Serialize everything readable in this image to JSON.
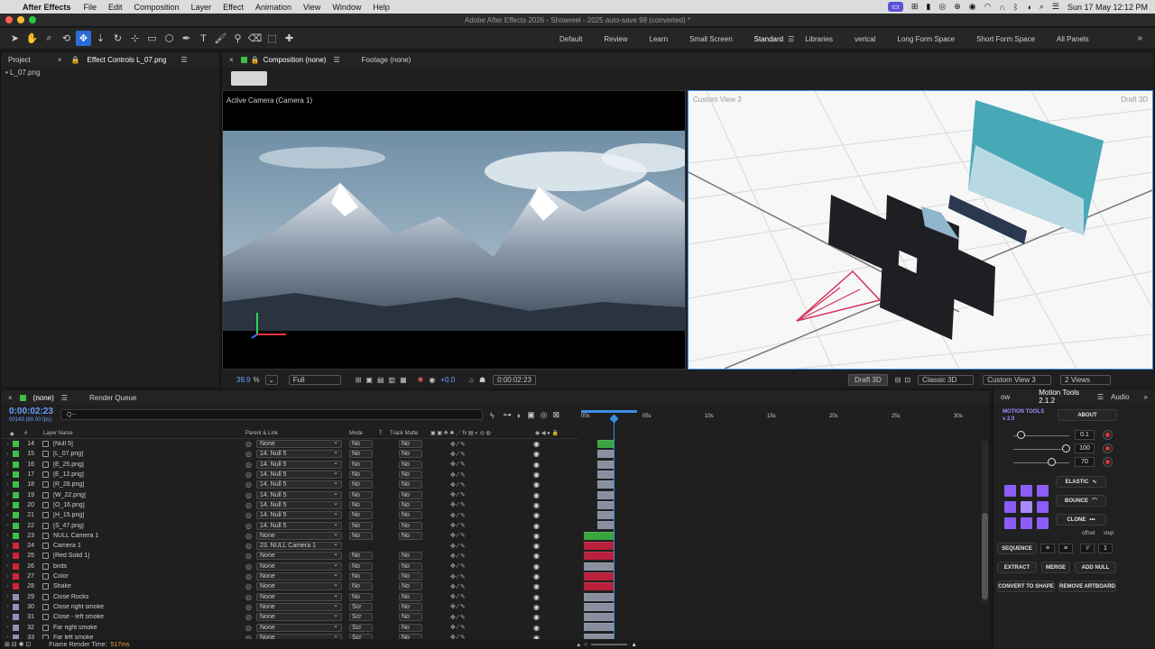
{
  "menubar": {
    "app": "After Effects",
    "items": [
      "File",
      "Edit",
      "Composition",
      "Layer",
      "Effect",
      "Animation",
      "View",
      "Window",
      "Help"
    ],
    "datetime": "Sun 17 May  12:12 PM"
  },
  "window": {
    "title": "Adobe After Effects 2026 - Showreel - 2025 auto-save 98 (converted) *"
  },
  "workspaces": [
    "Default",
    "Review",
    "Learn",
    "Small Screen",
    "Standard",
    "Libraries",
    "vertcal",
    "Long Form Space",
    "Short Form Space",
    "All Panels"
  ],
  "workspace_active": "Standard",
  "left_panel": {
    "tabs": [
      "Project",
      "Effect Controls L_07.png"
    ],
    "item": "L_07.png"
  },
  "comp_panel": {
    "tabs": [
      "Composition (none)",
      "Footage (none)"
    ],
    "left_view_label": "Active Camera (Camera 1)",
    "right_view_label": "Custom View 3",
    "right_view_corner": "Draft 3D"
  },
  "viewer_bar": {
    "zoom": "39.9",
    "zoom_unit": "%",
    "resolution": "Full",
    "exposure": "+0.0",
    "timecode": "0:00:02:23",
    "draft3d": "Draft 3D",
    "renderer": "Classic 3D",
    "view": "Custom View 3",
    "layout": "2 Views"
  },
  "timeline": {
    "tabs": [
      "(none)",
      "Render Queue"
    ],
    "timecode": "0:00:02:23",
    "fps": "00143 (60.00 fps)",
    "search_placeholder": "Q~",
    "headers": {
      "num": "#",
      "name": "Layer Name",
      "parent": "Parent & Link",
      "mode": "Mode",
      "t": "T",
      "matte": "Track Matte"
    },
    "ruler": [
      "00s",
      "05s",
      "10s",
      "15s",
      "20s",
      "25s",
      "30s"
    ],
    "footer": {
      "label": "Frame Render Time:",
      "value": "517ms"
    },
    "layers": [
      {
        "num": "14",
        "name": "[Null 5]",
        "parent": "None",
        "mode": "No",
        "matte": "No",
        "color": "#3dbf4a",
        "bar": "#3aa53f",
        "bs": 0.035,
        "be": 0.075
      },
      {
        "num": "15",
        "name": "[L_07.png]",
        "parent": "14. Null 5",
        "mode": "No",
        "matte": "No",
        "color": "#3dbf4a",
        "bar": "#8a8fa0",
        "bs": 0.035,
        "be": 0.075
      },
      {
        "num": "16",
        "name": "[E_25.png]",
        "parent": "14. Null 5",
        "mode": "No",
        "matte": "No",
        "color": "#3dbf4a",
        "bar": "#8a8fa0",
        "bs": 0.035,
        "be": 0.075
      },
      {
        "num": "17",
        "name": "[E_12.png]",
        "parent": "14. Null 5",
        "mode": "No",
        "matte": "No",
        "color": "#3dbf4a",
        "bar": "#8a8fa0",
        "bs": 0.035,
        "be": 0.075
      },
      {
        "num": "18",
        "name": "[R_28.png]",
        "parent": "14. Null 5",
        "mode": "No",
        "matte": "No",
        "color": "#3dbf4a",
        "bar": "#8a8fa0",
        "bs": 0.035,
        "be": 0.075
      },
      {
        "num": "19",
        "name": "[W_22.png]",
        "parent": "14. Null 5",
        "mode": "No",
        "matte": "No",
        "color": "#3dbf4a",
        "bar": "#8a8fa0",
        "bs": 0.035,
        "be": 0.075
      },
      {
        "num": "20",
        "name": "[O_16.png]",
        "parent": "14. Null 5",
        "mode": "No",
        "matte": "No",
        "color": "#3dbf4a",
        "bar": "#8a8fa0",
        "bs": 0.035,
        "be": 0.075
      },
      {
        "num": "21",
        "name": "[H_15.png]",
        "parent": "14. Null 5",
        "mode": "No",
        "matte": "No",
        "color": "#3dbf4a",
        "bar": "#8a8fa0",
        "bs": 0.035,
        "be": 0.075
      },
      {
        "num": "22",
        "name": "[S_47.png]",
        "parent": "14. Null 5",
        "mode": "No",
        "matte": "No",
        "color": "#3dbf4a",
        "bar": "#8a8fa0",
        "bs": 0.035,
        "be": 0.075
      },
      {
        "num": "23",
        "name": "NULL Camera 1",
        "parent": "None",
        "mode": "No",
        "matte": "No",
        "color": "#3dbf4a",
        "bar": "#3aa53f",
        "bs": 0.0,
        "be": 0.075
      },
      {
        "num": "24",
        "name": "Camera 1",
        "parent": "23. NULL Camera 1",
        "mode": "",
        "matte": "",
        "color": "#d0243a",
        "bar": "#b8203b",
        "bs": 0.0,
        "be": 0.075
      },
      {
        "num": "25",
        "name": "[Red Solid 1]",
        "parent": "None",
        "mode": "No",
        "matte": "No",
        "color": "#d0243a",
        "bar": "#b8203b",
        "bs": 0.0,
        "be": 0.075
      },
      {
        "num": "26",
        "name": "birds",
        "parent": "None",
        "mode": "No",
        "matte": "No",
        "color": "#d0243a",
        "bar": "#8a8fa0",
        "bs": 0.0,
        "be": 0.075
      },
      {
        "num": "27",
        "name": "Color",
        "parent": "None",
        "mode": "No",
        "matte": "No",
        "color": "#d0243a",
        "bar": "#b8203b",
        "bs": 0.0,
        "be": 0.075
      },
      {
        "num": "28",
        "name": "Shake",
        "parent": "None",
        "mode": "No",
        "matte": "No",
        "color": "#d0243a",
        "bar": "#b8203b",
        "bs": 0.0,
        "be": 0.075
      },
      {
        "num": "29",
        "name": "Close Rocks",
        "parent": "None",
        "mode": "No",
        "matte": "No",
        "color": "#8f92b6",
        "bar": "#8a8fa0",
        "bs": 0.0,
        "be": 0.075
      },
      {
        "num": "30",
        "name": "Close right smoke",
        "parent": "None",
        "mode": "Scr",
        "matte": "No",
        "color": "#8f92b6",
        "bar": "#8a8fa0",
        "bs": 0.0,
        "be": 0.075
      },
      {
        "num": "31",
        "name": "Close - left smoke",
        "parent": "None",
        "mode": "Scr",
        "matte": "No",
        "color": "#8f92b6",
        "bar": "#8a8fa0",
        "bs": 0.0,
        "be": 0.075
      },
      {
        "num": "32",
        "name": "Far right smoke",
        "parent": "None",
        "mode": "Scr",
        "matte": "No",
        "color": "#8f92b6",
        "bar": "#8a8fa0",
        "bs": 0.0,
        "be": 0.075
      },
      {
        "num": "33",
        "name": "Far left smoke",
        "parent": "None",
        "mode": "Scr",
        "matte": "No",
        "color": "#8f92b6",
        "bar": "#8a8fa0",
        "bs": 0.0,
        "be": 0.075
      }
    ]
  },
  "motion_tools": {
    "tabs": [
      "ow",
      "Motion Tools 2.1.2",
      "Audio"
    ],
    "logo": "MOTION TOOLS v 2.0",
    "about": "ABOUT",
    "values": {
      "v1": "0.1",
      "v2": "100",
      "v3": "70"
    },
    "buttons": {
      "elastic": "ELASTIC",
      "bounce": "BOUNCE",
      "clone": "CLONE",
      "offset": "offset",
      "step": "step",
      "sequence": "SEQUENCE",
      "seq_val": "1",
      "extract": "EXTRACT",
      "merge": "MERGE",
      "add_null": "ADD NULL",
      "convert": "CONVERT TO SHAPE",
      "remove": "REMOVE ARTBOARD"
    }
  },
  "colors": {
    "accent": "#2d6bd8",
    "playhead": "#3a8ee6",
    "purple": "#8b5cf6"
  }
}
